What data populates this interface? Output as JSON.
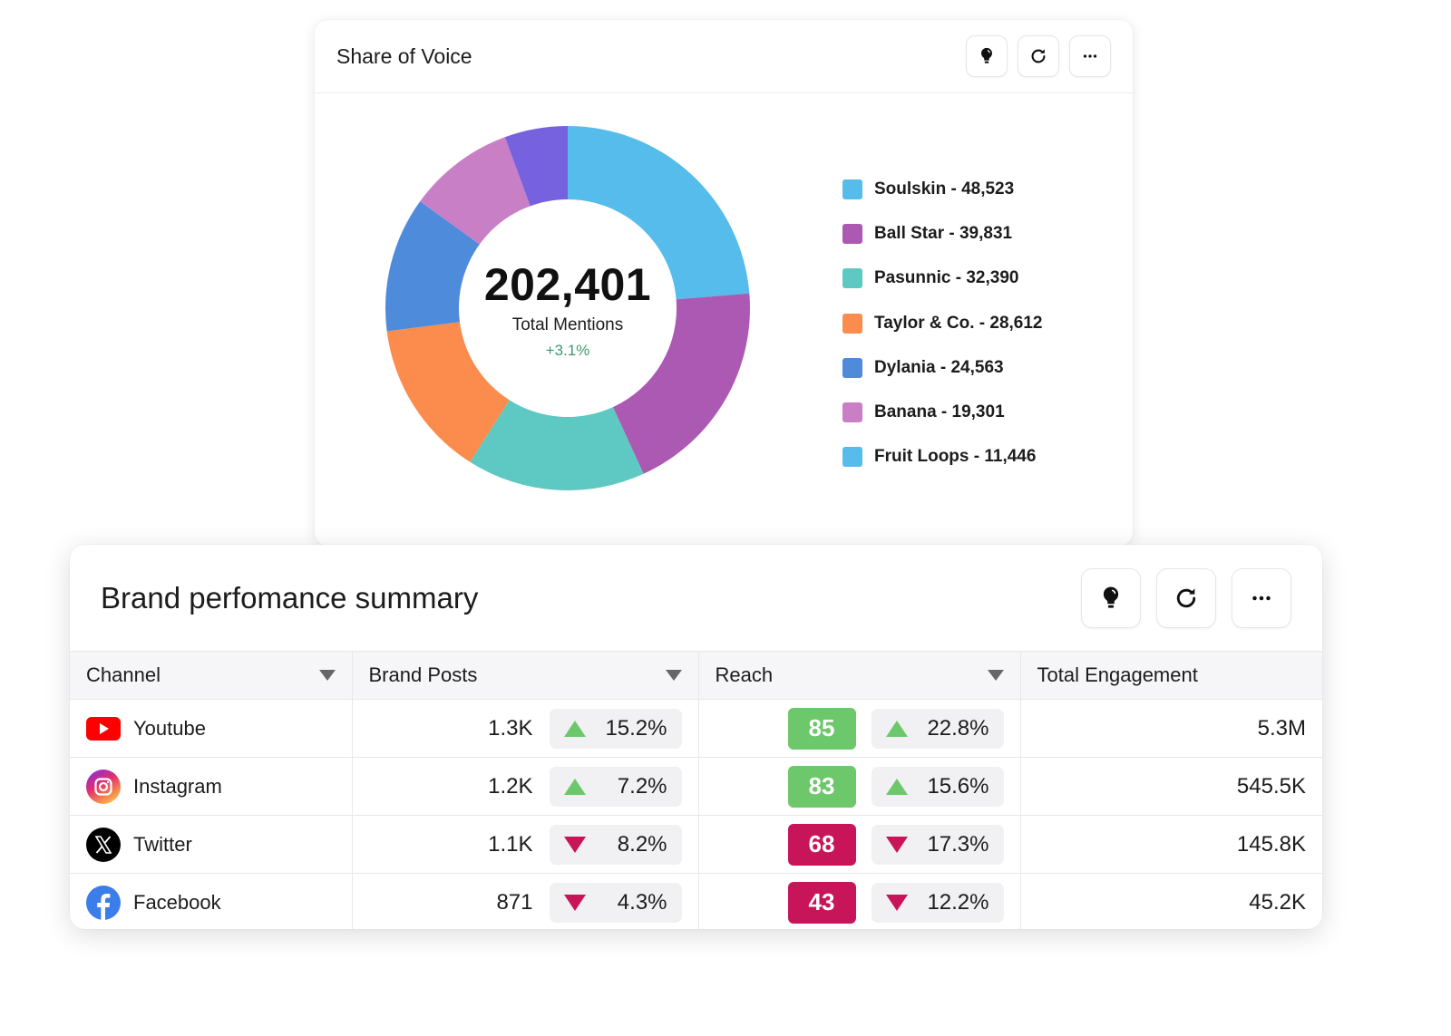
{
  "share_of_voice": {
    "title": "Share of Voice",
    "actions": [
      {
        "name": "insights",
        "icon": "lightbulb-icon"
      },
      {
        "name": "refresh",
        "icon": "refresh-icon"
      },
      {
        "name": "more",
        "icon": "more-horizontal-icon"
      }
    ],
    "total_value": "202,401",
    "total_label": "Total Mentions",
    "total_change": "+3.1%",
    "legend": [
      {
        "label": "Soulskin - 48,523",
        "color": "#55bcec"
      },
      {
        "label": "Ball Star - 39,831",
        "color": "#ab59b2"
      },
      {
        "label": "Pasunnic - 32,390",
        "color": "#5ec8c2"
      },
      {
        "label": "Taylor & Co. - 28,612",
        "color": "#fb8c4d"
      },
      {
        "label": "Dylania - 24,563",
        "color": "#4f8bdb"
      },
      {
        "label": "Banana - 19,301",
        "color": "#c97fc6"
      },
      {
        "label": "Fruit Loops - 11,446",
        "color": "#55bcec"
      }
    ]
  },
  "chart_data": {
    "type": "pie",
    "variant": "donut",
    "title": "Share of Voice",
    "center_text": {
      "value": "202,401",
      "label": "Total Mentions",
      "change": "+3.1%"
    },
    "categories": [
      "Soulskin",
      "Ball Star",
      "Pasunnic",
      "Taylor & Co.",
      "Dylania",
      "Banana",
      "Fruit Loops"
    ],
    "values": [
      48523,
      39831,
      32390,
      28612,
      24563,
      19301,
      11446
    ],
    "slice_colors": [
      "#55bcec",
      "#ab59b2",
      "#5ec8c2",
      "#fb8c4d",
      "#4f8bdb",
      "#c97fc6",
      "#7661de"
    ],
    "legend_position": "right"
  },
  "brand_performance": {
    "title": "Brand perfomance summary",
    "actions": [
      {
        "name": "insights",
        "icon": "lightbulb-icon"
      },
      {
        "name": "refresh",
        "icon": "refresh-icon"
      },
      {
        "name": "more",
        "icon": "more-horizontal-icon"
      }
    ],
    "columns": [
      {
        "label": "Channel",
        "sortable": true
      },
      {
        "label": "Brand Posts",
        "sortable": true
      },
      {
        "label": "Reach",
        "sortable": true
      },
      {
        "label": "Total Engagement",
        "sortable": false
      }
    ],
    "rows": [
      {
        "channel": "Youtube",
        "icon": "youtube-icon",
        "brand_posts": "1.3K",
        "posts_change": "15.2%",
        "posts_trend": "up",
        "reach_score": "85",
        "reach_change": "22.8%",
        "reach_trend": "up",
        "engagement": "5.3M"
      },
      {
        "channel": "Instagram",
        "icon": "instagram-icon",
        "brand_posts": "1.2K",
        "posts_change": "7.2%",
        "posts_trend": "up",
        "reach_score": "83",
        "reach_change": "15.6%",
        "reach_trend": "up",
        "engagement": "545.5K"
      },
      {
        "channel": "Twitter",
        "icon": "x-twitter-icon",
        "brand_posts": "1.1K",
        "posts_change": "8.2%",
        "posts_trend": "down",
        "reach_score": "68",
        "reach_change": "17.3%",
        "reach_trend": "down",
        "engagement": "145.8K"
      },
      {
        "channel": "Facebook",
        "icon": "facebook-icon",
        "brand_posts": "871",
        "posts_change": "4.3%",
        "posts_trend": "down",
        "reach_score": "43",
        "reach_change": "12.2%",
        "reach_trend": "down",
        "engagement": "45.2K"
      }
    ],
    "colors": {
      "positive_score": "#6cc86a",
      "negative_score": "#c8155a"
    }
  }
}
